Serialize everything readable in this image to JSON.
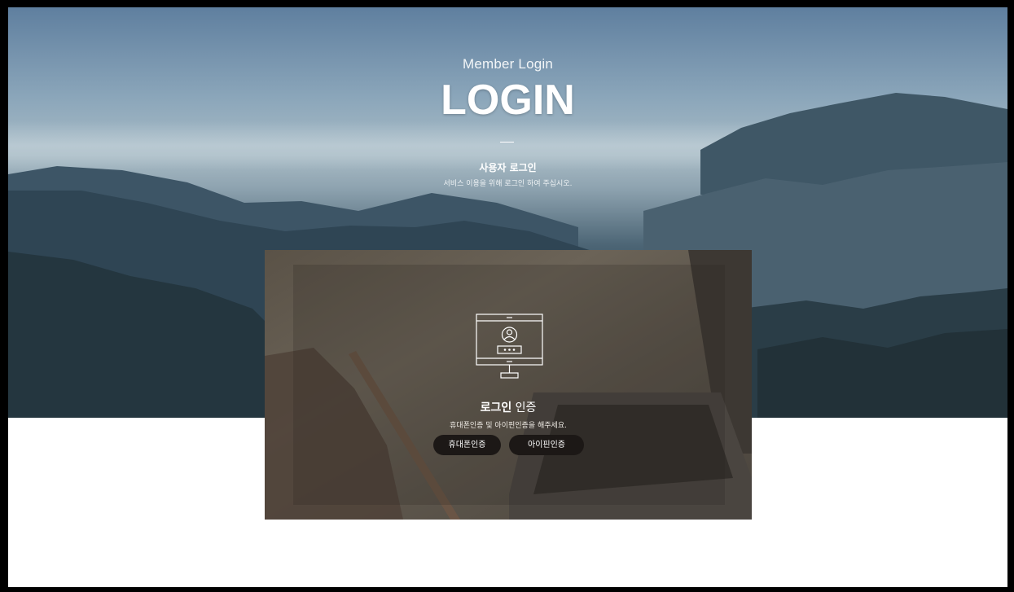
{
  "hero": {
    "subtitle": "Member Login",
    "title": "LOGIN",
    "section_title": "사용자 로그인",
    "section_desc": "서비스 이용을 위해 로그인 하여 주십시오."
  },
  "auth": {
    "icon": "monitor-user-login-icon",
    "title_bold": "로그인",
    "title_rest": " 인증",
    "desc": "휴대폰인증 및 아이핀인증을 해주세요.",
    "btn_phone": "휴대폰인증",
    "btn_ipin": "아이핀인증"
  },
  "colors": {
    "frame": "#000000",
    "button_bg": "#1c1816",
    "text": "#ffffff"
  }
}
